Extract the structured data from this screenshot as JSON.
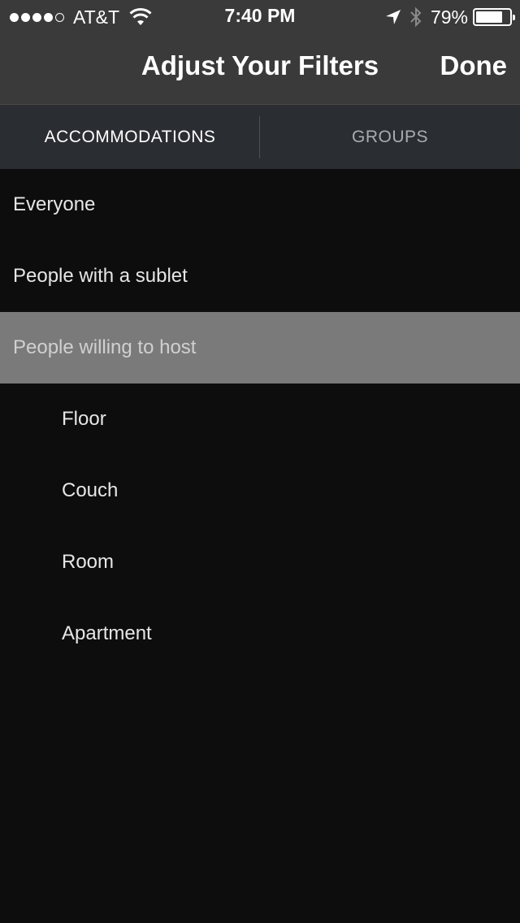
{
  "status_bar": {
    "carrier": "AT&T",
    "signal_dots_filled": 4,
    "signal_dots_total": 5,
    "time": "7:40 PM",
    "battery_percent": "79%",
    "icons": [
      "wifi-icon",
      "location-arrow-icon",
      "bluetooth-icon",
      "battery-icon"
    ]
  },
  "nav": {
    "title": "Adjust Your Filters",
    "done_label": "Done"
  },
  "tabs": [
    {
      "label": "ACCOMMODATIONS",
      "active": true
    },
    {
      "label": "GROUPS",
      "active": false
    }
  ],
  "options": [
    {
      "label": "Everyone",
      "level": 0,
      "selected": false
    },
    {
      "label": "People with a sublet",
      "level": 0,
      "selected": false
    },
    {
      "label": "People willing to host",
      "level": 0,
      "selected": true
    },
    {
      "label": "Floor",
      "level": 1,
      "selected": false
    },
    {
      "label": "Couch",
      "level": 1,
      "selected": false
    },
    {
      "label": "Room",
      "level": 1,
      "selected": false
    },
    {
      "label": "Apartment",
      "level": 1,
      "selected": false
    }
  ],
  "colors": {
    "header_bg": "#3a3a3a",
    "tabs_bg": "#2a2d31",
    "list_bg": "#0d0d0d",
    "selected_row_bg": "#7a7a7a"
  }
}
